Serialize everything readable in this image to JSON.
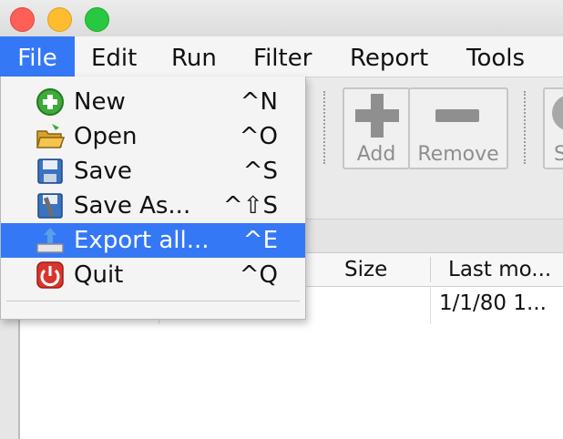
{
  "menubar": {
    "items": [
      {
        "label": "File",
        "active": true
      },
      {
        "label": "Edit"
      },
      {
        "label": "Run"
      },
      {
        "label": "Filter"
      },
      {
        "label": "Report"
      },
      {
        "label": "Tools"
      }
    ]
  },
  "file_menu": {
    "items": [
      {
        "label": "New",
        "shortcut": "^N",
        "icon": "new-icon"
      },
      {
        "label": "Open",
        "shortcut": "^O",
        "icon": "open-folder-icon"
      },
      {
        "label": "Save",
        "shortcut": "^S",
        "icon": "save-icon"
      },
      {
        "label": "Save As...",
        "shortcut": "^⇧S",
        "icon": "save-as-icon"
      },
      {
        "label": "Export all...",
        "shortcut": "^E",
        "icon": "export-icon",
        "highlighted": true
      },
      {
        "label": "Quit",
        "shortcut": "^Q",
        "icon": "quit-icon"
      }
    ]
  },
  "toolbar": {
    "add_label": "Add",
    "remove_label": "Remove",
    "partial_label": "S"
  },
  "table": {
    "columns": [
      "Size",
      "Last mo..."
    ],
    "rows": [
      {
        "last_modified": "1/1/80 1..."
      }
    ]
  },
  "colors": {
    "accent": "#3478f6",
    "close": "#fe5f57",
    "minimize": "#febc2e",
    "maximize": "#28c840"
  }
}
